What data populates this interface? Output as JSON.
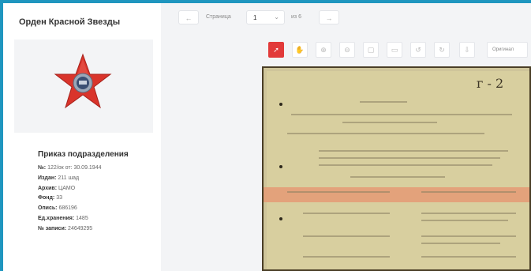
{
  "award": {
    "title": "Орден Красной Звезды"
  },
  "document_info": {
    "title": "Приказ подразделения",
    "rows": [
      {
        "label": "№:",
        "value": "122/ок от: 30.09.1944"
      },
      {
        "label": "Издан:",
        "value": "211 шад"
      },
      {
        "label": "Архив:",
        "value": "ЦАМО"
      },
      {
        "label": "Фонд:",
        "value": "33"
      },
      {
        "label": "Опись:",
        "value": "686196"
      },
      {
        "label": "Ед.хранения:",
        "value": "1485"
      },
      {
        "label": "№ записи:",
        "value": "24649295"
      }
    ]
  },
  "pager": {
    "prev": "←",
    "page_label": "Страница",
    "page_value": "1",
    "of_label": "из 6",
    "next": "→"
  },
  "toolbar": {
    "icons": [
      "cursor-icon",
      "hand-icon",
      "zoom-in-icon",
      "zoom-out-icon",
      "fit-page-icon",
      "fit-width-icon",
      "rotate-left-icon",
      "rotate-right-icon",
      "download-icon"
    ],
    "text_button": "Оригинал"
  },
  "document_image": {
    "handwritten_mark": "г - 2"
  },
  "colors": {
    "accent": "#1f96bf",
    "active_tool": "#e23a3a"
  }
}
